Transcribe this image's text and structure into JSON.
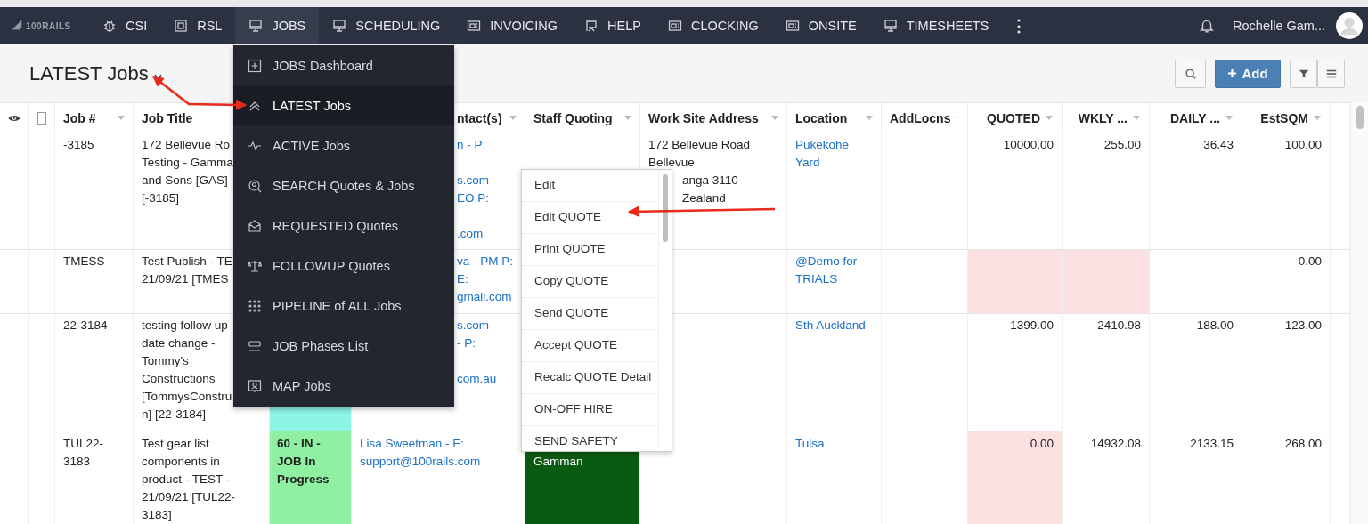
{
  "nav": {
    "logo": "100RAILS",
    "items": [
      {
        "label": "CSI",
        "selected": false
      },
      {
        "label": "RSL",
        "selected": false
      },
      {
        "label": "JOBS",
        "selected": true
      },
      {
        "label": "SCHEDULING",
        "selected": false
      },
      {
        "label": "INVOICING",
        "selected": false
      },
      {
        "label": "HELP",
        "selected": false
      },
      {
        "label": "CLOCKING",
        "selected": false
      },
      {
        "label": "ONSITE",
        "selected": false
      },
      {
        "label": "TIMESHEETS",
        "selected": false
      }
    ],
    "more": "⋮",
    "user": "Rochelle Gam..."
  },
  "page": {
    "title": "LATEST Jobs",
    "add_button": "Add"
  },
  "jobs_menu": [
    {
      "label": "JOBS Dashboard",
      "selected": false
    },
    {
      "label": "LATEST Jobs",
      "selected": true
    },
    {
      "label": "ACTIVE Jobs",
      "selected": false
    },
    {
      "label": "SEARCH Quotes & Jobs",
      "selected": false
    },
    {
      "label": "REQUESTED Quotes",
      "selected": false
    },
    {
      "label": "FOLLOWUP Quotes",
      "selected": false
    },
    {
      "label": "PIPELINE of ALL Jobs",
      "selected": false
    },
    {
      "label": "JOB Phases List",
      "selected": false
    },
    {
      "label": "MAP Jobs",
      "selected": false
    }
  ],
  "context_menu": [
    "Edit",
    "Edit QUOTE",
    "Print QUOTE",
    "Copy QUOTE",
    "Send QUOTE",
    "Accept QUOTE",
    "Recalc QUOTE Detail",
    "ON-OFF HIRE",
    "SEND SAFETY"
  ],
  "table": {
    "select_all_checked": false,
    "columns": [
      "Job #",
      "Job Title",
      "ntact(s)",
      "Staff Quoting",
      "Work Site Address",
      "Location",
      "AddLocns",
      "QUOTED",
      "WKLY ...",
      "DAILY ...",
      "EstSQM"
    ],
    "rows": [
      {
        "job": "-3185",
        "title": [
          "172 Bellevue Ro",
          "Testing - Gamma",
          "and Sons [GAS]",
          "[-3185]"
        ],
        "contact": [
          "n - P:",
          "s.com",
          "EO P:",
          ".com"
        ],
        "address": [
          "172 Bellevue Road",
          "Bellevue"
        ],
        "address_fragments": [
          "anga 3110",
          "Zealand"
        ],
        "location": "Pukekohe Yard",
        "quoted": {
          "text": "10000.00",
          "flagged": false
        },
        "weekly": {
          "text": "255.00",
          "flagged": false
        },
        "daily": "36.43",
        "estsqm": "100.00"
      },
      {
        "job": "TMESS",
        "title": [
          "Test Publish - TE",
          "21/09/21 [TMES"
        ],
        "contact": [
          "va - PM P:",
          "E:",
          "gmail.com"
        ],
        "location": "@Demo for TRIALS",
        "quoted": {
          "flagged": true
        },
        "weekly": {
          "flagged": true
        },
        "estsqm": "0.00"
      },
      {
        "job": "22-3184",
        "title": [
          "testing follow up",
          "date change -",
          "Tommy's",
          "Constructions",
          "[TommysConstru",
          "n] [22-3184]"
        ],
        "status": {
          "color": "#8ef5e6"
        },
        "contact": [
          "s.com",
          "- P:",
          "com.au"
        ],
        "location": "Sth Auckland",
        "quoted": {
          "text": "1399.00",
          "flagged": false
        },
        "weekly": {
          "text": "2410.98",
          "flagged": false
        },
        "daily": "188.00",
        "estsqm": "123.00"
      },
      {
        "job": "TUL22-3183",
        "title": [
          "Test gear list components in product - TEST - 21/09/21 [TUL22-3183]"
        ],
        "status": {
          "text": "60 - IN - JOB In Progress",
          "color": "#8ef0a0"
        },
        "contact_full": "Lisa Sweetman - E: support@100rails.com",
        "staff": {
          "text": "Gamman",
          "color": "#0b5a12"
        },
        "location": "Tulsa",
        "quoted": {
          "text": "0.00",
          "flagged": true
        },
        "weekly": {
          "text": "14932.08",
          "flagged": false
        },
        "daily": "2133.15",
        "estsqm": "268.00"
      }
    ]
  }
}
